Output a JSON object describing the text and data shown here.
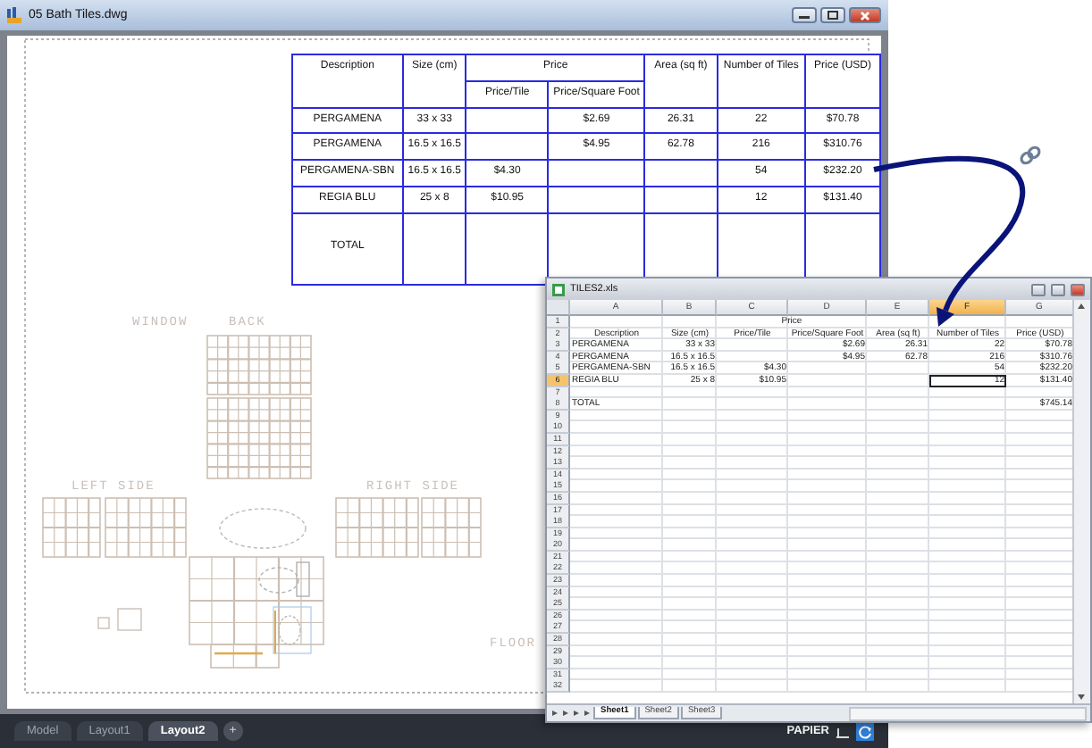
{
  "main_window": {
    "title": "05 Bath Tiles.dwg"
  },
  "price_table": {
    "headers": {
      "description": "Description",
      "size": "Size (cm)",
      "price": "Price",
      "price_per_tile": "Price/Tile",
      "price_per_square_foot": "Price/Square Foot",
      "area": "Area (sq ft)",
      "number_of_tiles": "Number of Tiles",
      "price_usd": "Price (USD)"
    },
    "rows": [
      {
        "description": "PERGAMENA",
        "size": "33 x 33",
        "price_per_square_foot": "$2.69",
        "area": "26.31",
        "number_of_tiles": "22",
        "price_usd": "$70.78"
      },
      {
        "description": "PERGAMENA",
        "size": "16.5 x 16.5",
        "price_per_square_foot": "$4.95",
        "area": "62.78",
        "number_of_tiles": "216",
        "price_usd": "$310.76"
      },
      {
        "description": "PERGAMENA-SBN",
        "size": "16.5 x 16.5",
        "price_per_tile": "$4.30",
        "number_of_tiles": "54",
        "price_usd": "$232.20"
      },
      {
        "description": "REGIA BLU",
        "size": "25 x 8",
        "price_per_tile": "$10.95",
        "number_of_tiles": "12",
        "price_usd": "$131.40"
      },
      {
        "description": "TOTAL"
      }
    ]
  },
  "drawing_labels": [
    "WINDOW",
    "BACK",
    "LEFT SIDE",
    "RIGHT SIDE",
    "FLOOR"
  ],
  "layout_tabs": [
    {
      "label": "Model",
      "selected": false
    },
    {
      "label": "Layout1",
      "selected": false
    },
    {
      "label": "Layout2",
      "selected": true
    }
  ],
  "add_layout_button": "+",
  "status_bar": {
    "paper_mode": "PAPIER"
  },
  "spreadsheet": {
    "title": "TILES2.xls",
    "columns": [
      {
        "label": "A",
        "selected": false
      },
      {
        "label": "B",
        "selected": false
      },
      {
        "label": "C",
        "selected": false
      },
      {
        "label": "D",
        "selected": false
      },
      {
        "label": "E",
        "selected": false
      },
      {
        "label": "F",
        "selected": true
      },
      {
        "label": "G",
        "selected": false
      }
    ],
    "rows": [
      {
        "number": "1",
        "kind": "header",
        "selected": false,
        "merged": true,
        "cells": {
          "C": "Price"
        }
      },
      {
        "number": "2",
        "kind": "header",
        "selected": false,
        "merged": false,
        "cells": {
          "A": "Description",
          "B": "Size (cm)",
          "C": "Price/Tile",
          "D": "Price/Square Foot",
          "E": "Area (sq ft)",
          "F": "Number of Tiles",
          "G": "Price (USD)"
        }
      },
      {
        "number": "3",
        "kind": "data",
        "selected": false,
        "merged": false,
        "cells": {
          "A": "PERGAMENA",
          "B": "33 x 33",
          "D": "$2.69",
          "E": "26.31",
          "F": "22",
          "G": "$70.78"
        }
      },
      {
        "number": "4",
        "kind": "data",
        "selected": false,
        "merged": false,
        "cells": {
          "A": "PERGAMENA",
          "B": "16.5 x 16.5",
          "D": "$4.95",
          "E": "62.78",
          "F": "216",
          "G": "$310.76"
        }
      },
      {
        "number": "5",
        "kind": "data",
        "selected": false,
        "merged": false,
        "cells": {
          "A": "PERGAMENA-SBN",
          "B": "16.5 x 16.5",
          "C": "$4.30",
          "F": "54",
          "G": "$232.20"
        }
      },
      {
        "number": "6",
        "kind": "data",
        "selected": true,
        "merged": false,
        "cells": {
          "A": "REGIA BLU",
          "B": "25 x 8",
          "C": "$10.95",
          "F": "12",
          "G": "$131.40"
        }
      },
      {
        "number": "7",
        "kind": "data",
        "selected": false,
        "merged": false,
        "cells": {}
      },
      {
        "number": "8",
        "kind": "data",
        "selected": false,
        "merged": false,
        "cells": {
          "A": "TOTAL",
          "G": "$745.14"
        }
      },
      {
        "number": "9",
        "kind": "data",
        "selected": false,
        "merged": false,
        "cells": {}
      },
      {
        "number": "10",
        "kind": "data",
        "selected": false,
        "merged": false,
        "cells": {}
      },
      {
        "number": "11",
        "kind": "data",
        "selected": false,
        "merged": false,
        "cells": {}
      },
      {
        "number": "12",
        "kind": "data",
        "selected": false,
        "merged": false,
        "cells": {}
      },
      {
        "number": "13",
        "kind": "data",
        "selected": false,
        "merged": false,
        "cells": {}
      },
      {
        "number": "14",
        "kind": "data",
        "selected": false,
        "merged": false,
        "cells": {}
      },
      {
        "number": "15",
        "kind": "data",
        "selected": false,
        "merged": false,
        "cells": {}
      },
      {
        "number": "16",
        "kind": "data",
        "selected": false,
        "merged": false,
        "cells": {}
      },
      {
        "number": "17",
        "kind": "data",
        "selected": false,
        "merged": false,
        "cells": {}
      },
      {
        "number": "18",
        "kind": "data",
        "selected": false,
        "merged": false,
        "cells": {}
      },
      {
        "number": "19",
        "kind": "data",
        "selected": false,
        "merged": false,
        "cells": {}
      },
      {
        "number": "20",
        "kind": "data",
        "selected": false,
        "merged": false,
        "cells": {}
      },
      {
        "number": "21",
        "kind": "data",
        "selected": false,
        "merged": false,
        "cells": {}
      },
      {
        "number": "22",
        "kind": "data",
        "selected": false,
        "merged": false,
        "cells": {}
      },
      {
        "number": "23",
        "kind": "data",
        "selected": false,
        "merged": false,
        "cells": {}
      },
      {
        "number": "24",
        "kind": "data",
        "selected": false,
        "merged": false,
        "cells": {}
      },
      {
        "number": "25",
        "kind": "data",
        "selected": false,
        "merged": false,
        "cells": {}
      },
      {
        "number": "26",
        "kind": "data",
        "selected": false,
        "merged": false,
        "cells": {}
      },
      {
        "number": "27",
        "kind": "data",
        "selected": false,
        "merged": false,
        "cells": {}
      },
      {
        "number": "28",
        "kind": "data",
        "selected": false,
        "merged": false,
        "cells": {}
      },
      {
        "number": "29",
        "kind": "data",
        "selected": false,
        "merged": false,
        "cells": {}
      },
      {
        "number": "30",
        "kind": "data",
        "selected": false,
        "merged": false,
        "cells": {}
      },
      {
        "number": "31",
        "kind": "data",
        "selected": false,
        "merged": false,
        "cells": {}
      },
      {
        "number": "32",
        "kind": "data",
        "selected": false,
        "merged": false,
        "cells": {}
      }
    ],
    "sheet_tabs": [
      {
        "label": "Sheet1",
        "selected": true
      },
      {
        "label": "Sheet2",
        "selected": false
      },
      {
        "label": "Sheet3",
        "selected": false
      }
    ]
  }
}
